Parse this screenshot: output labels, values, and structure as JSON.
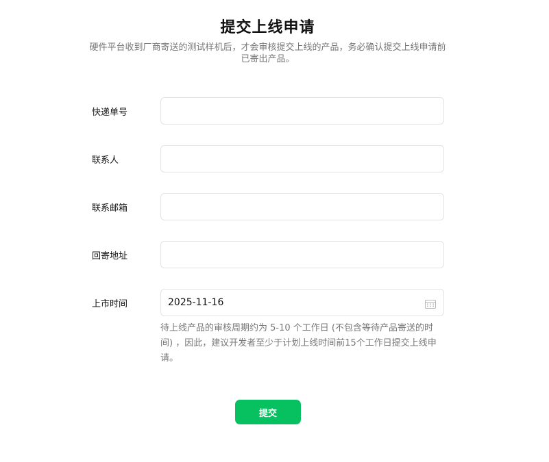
{
  "header": {
    "title": "提交上线申请",
    "subtitle": "硬件平台收到厂商寄送的测试样机后，才会审核提交上线的产品，务必确认提交上线申请前已寄出产品。"
  },
  "form": {
    "tracking": {
      "label": "快递单号",
      "value": "",
      "placeholder": ""
    },
    "contact": {
      "label": "联系人",
      "value": "",
      "placeholder": ""
    },
    "email": {
      "label": "联系邮箱",
      "value": "",
      "placeholder": ""
    },
    "address": {
      "label": "回寄地址",
      "value": "",
      "placeholder": ""
    },
    "launch_date": {
      "label": "上市时间",
      "value": "2025-11-16",
      "icon": "calendar-icon"
    },
    "hint": "待上线产品的审核周期约为 5-10 个工作日 (不包含等待产品寄送的时间) ，因此，建议开发者至少于计划上线时间前15个工作日提交上线申请。"
  },
  "actions": {
    "submit_label": "提交"
  },
  "colors": {
    "accent": "#07c160",
    "border": "#e3e3e3",
    "muted_text": "#777777"
  }
}
